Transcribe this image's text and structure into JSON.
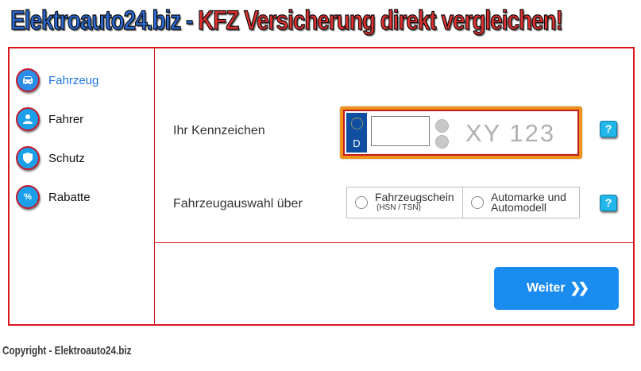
{
  "banner": {
    "site": "Elektroauto24.biz",
    "separator": "-",
    "tagline": "KFZ Versicherung direkt vergleichen!"
  },
  "sidebar": {
    "items": [
      {
        "label": "Fahrzeug",
        "icon": "car-icon",
        "active": true
      },
      {
        "label": "Fahrer",
        "icon": "person-icon",
        "active": false
      },
      {
        "label": "Schutz",
        "icon": "shield-icon",
        "active": false
      },
      {
        "label": "Rabatte",
        "icon": "percent-icon",
        "active": false,
        "glyph": "%"
      }
    ]
  },
  "form": {
    "license_label": "Ihr Kennzeichen",
    "plate": {
      "country": "D",
      "input_value": "",
      "placeholder": "XY 123"
    },
    "help_glyph": "?",
    "selection_label": "Fahrzeugauswahl über",
    "options": [
      {
        "main": "Fahrzeugschein",
        "sub": "(HSN / TSN)"
      },
      {
        "main": "Automarke und",
        "sub": "Automodell"
      }
    ],
    "next_button": "Weiter",
    "next_arrows": "❯❯"
  },
  "footer": {
    "copyright": "Copyright - Elektroauto24.biz"
  },
  "colors": {
    "border": "#d9161d",
    "accent": "#1a8cf0",
    "plate_frame": "#f0931e",
    "help": "#22b7ea"
  }
}
